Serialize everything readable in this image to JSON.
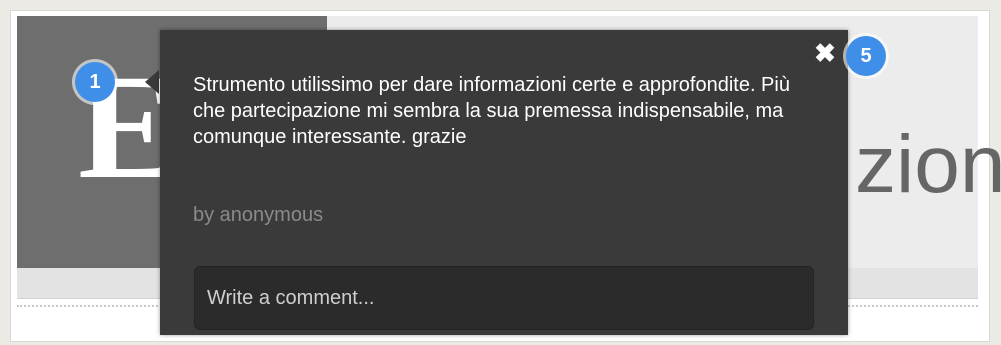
{
  "background": {
    "logo_letter": "E",
    "title_fragment": "zion"
  },
  "markers": {
    "left": "1",
    "right": "5"
  },
  "popup": {
    "close_symbol": "✖",
    "comment_text": "Strumento utilissimo per dare informazioni certe e approfondite. Più che partecipazione mi sembra la sua premessa indispensabile, ma comunque interessante. grazie",
    "author": "by anonymous",
    "input_placeholder": "Write a comment..."
  },
  "colors": {
    "popup_background": "#3a3a3a",
    "marker_blue": "#3f8ee8",
    "header_gray": "#6e6e6e"
  },
  "icons": {
    "close": "close-icon"
  }
}
